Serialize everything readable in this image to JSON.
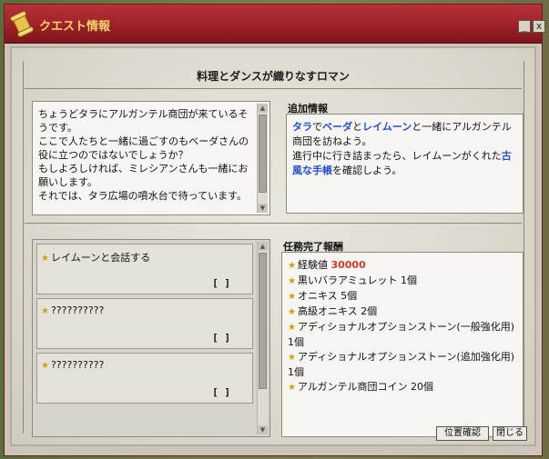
{
  "window": {
    "title": "クエスト情報",
    "minimize": "_",
    "close": "x"
  },
  "quest": {
    "title": "料理とダンスが織りなすロマン",
    "description": "ちょうどタラにアルガンテル商団が来ているそうです。\nここで人たちと一緒に過ごすのもベーダさんの役に立つのではないでしょうか？\nもしよろしければ、ミレシアンさんも一緒にお願いします。\nそれでは、タラ広場の噴水台で待っています。"
  },
  "info": {
    "heading": "追加情報",
    "line1_parts": [
      "タラ",
      "で",
      "ベーダ",
      "と",
      "レイムーン",
      "と一緒にアルガンテル商団を訪ねよう。"
    ],
    "line2_parts": [
      "進行中に行き詰まったら、レイムーンがくれた",
      "古風な手帳",
      "を確認しよう。"
    ]
  },
  "objectives": [
    {
      "label": "レイムーンと会話する",
      "status": "[  ]"
    },
    {
      "label": "??????????",
      "status": "[  ]"
    },
    {
      "label": "??????????",
      "status": "[  ]"
    }
  ],
  "rewards": {
    "heading": "任務完了報酬",
    "exp_label": "経験値",
    "exp_value": "30000",
    "items": [
      "黒いバラアミュレット 1個",
      "オニキス 5個",
      "高級オニキス 2個",
      "アディショナルオプションストーン(一般強化用) 1個",
      "アディショナルオプションストーン(追加強化用) 1個",
      "アルガンテル商団コイン 20個"
    ]
  },
  "buttons": {
    "position": "位置確認",
    "close": "閉じる"
  },
  "colors": {
    "titlebar": "#9a1f27",
    "title_text": "#f6d46a",
    "highlight": "#1f4fd0",
    "exp": "#d83a2a"
  }
}
